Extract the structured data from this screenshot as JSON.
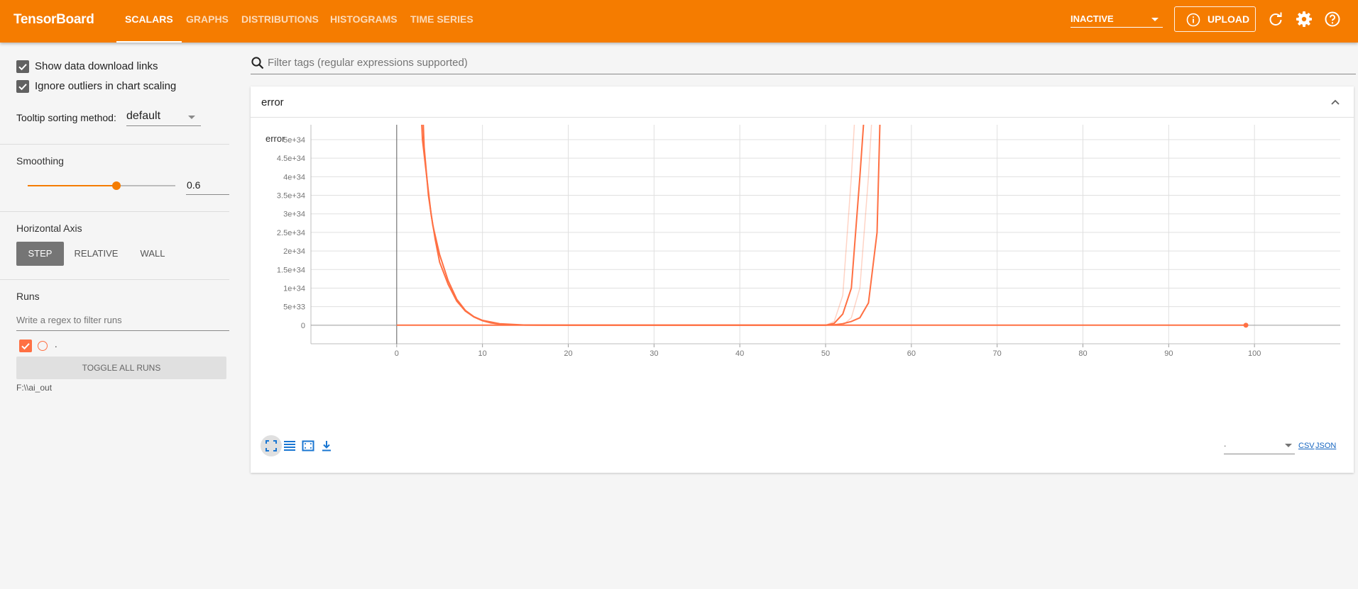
{
  "app": {
    "title": "TensorBoard"
  },
  "nav": {
    "tabs": [
      {
        "label": "SCALARS",
        "active": true
      },
      {
        "label": "GRAPHS"
      },
      {
        "label": "DISTRIBUTIONS"
      },
      {
        "label": "HISTOGRAMS"
      },
      {
        "label": "TIME SERIES"
      }
    ],
    "inactive_select": "INACTIVE",
    "upload_label": "UPLOAD",
    "icons": [
      "refresh-icon",
      "settings-icon",
      "help-icon"
    ]
  },
  "sidebar": {
    "show_download_links": {
      "label": "Show data download links",
      "checked": true
    },
    "ignore_outliers": {
      "label": "Ignore outliers in chart scaling",
      "checked": true
    },
    "tooltip_sorting": {
      "label": "Tooltip sorting method:",
      "value": "default"
    },
    "smoothing": {
      "title": "Smoothing",
      "value": "0.6",
      "fraction": 0.6
    },
    "horizontal_axis": {
      "title": "Horizontal Axis",
      "options": [
        "STEP",
        "RELATIVE",
        "WALL"
      ],
      "selected": "STEP"
    },
    "runs": {
      "title": "Runs",
      "filter_placeholder": "Write a regex to filter runs",
      "items": [
        {
          "name": ".",
          "checked": true,
          "color": "#ff7043"
        }
      ],
      "toggle_all_label": "TOGGLE ALL RUNS",
      "logdir": "F:\\\\ai_out"
    }
  },
  "main": {
    "filter_placeholder": "Filter tags (regular expressions supported)",
    "card": {
      "title": "error"
    },
    "download": {
      "selected": ".",
      "csv": "CSV",
      "json": "JSON"
    }
  },
  "colors": {
    "accent": "#f57c00",
    "run": "#ff7043"
  },
  "chart_data": {
    "type": "line",
    "title": "error",
    "xlabel": "",
    "ylabel": "",
    "xlim": [
      -10,
      110
    ],
    "ylim": [
      -5e+33,
      5.4e+34
    ],
    "x_ticks": [
      0,
      10,
      20,
      30,
      40,
      50,
      60,
      70,
      80,
      90,
      100
    ],
    "x_tick_labels": [
      "0",
      "10",
      "20",
      "30",
      "40",
      "50",
      "60",
      "70",
      "80",
      "90",
      "100"
    ],
    "y_ticks": [
      0,
      5e+33,
      1e+34,
      1.5e+34,
      2e+34,
      2.5e+34,
      3e+34,
      3.5e+34,
      4e+34,
      4.5e+34,
      5e+34
    ],
    "y_tick_labels": [
      "0",
      "5e+33",
      "1e+34",
      "1.5e+34",
      "2e+34",
      "2.5e+34",
      "3e+34",
      "3.5e+34",
      "4e+34",
      "4.5e+34",
      "5e+34"
    ],
    "grid": true,
    "series": [
      {
        "style": "smoothed",
        "points": [
          [
            2.8,
            6e+34
          ],
          [
            3,
            5e+34
          ],
          [
            3.5,
            4e+34
          ],
          [
            4,
            3e+34
          ],
          [
            4.5,
            2.3e+34
          ],
          [
            5,
            1.7e+34
          ],
          [
            6,
            1.1e+34
          ],
          [
            7,
            6.5e+33
          ],
          [
            8,
            3.8e+33
          ],
          [
            9,
            2.2e+33
          ],
          [
            10,
            1.2e+33
          ],
          [
            11,
            6e+32
          ],
          [
            12,
            3e+32
          ],
          [
            14,
            8e+31
          ],
          [
            17,
            1e+31
          ],
          [
            20,
            0
          ],
          [
            50,
            0
          ],
          [
            51,
            1e+32
          ],
          [
            52,
            4e+32
          ],
          [
            53,
            1e+33
          ],
          [
            54,
            2e+33
          ],
          [
            55,
            6e+33
          ],
          [
            56,
            2.5e+34
          ],
          [
            56.4,
            6e+34
          ]
        ]
      },
      {
        "style": "smoothed",
        "points": [
          [
            3,
            6e+34
          ],
          [
            3.2,
            4.8e+34
          ],
          [
            3.7,
            3.5e+34
          ],
          [
            4.2,
            2.7e+34
          ],
          [
            5,
            1.9e+34
          ],
          [
            6,
            1.2e+34
          ],
          [
            7,
            7e+33
          ],
          [
            8,
            4e+33
          ],
          [
            9,
            2.3e+33
          ],
          [
            10,
            1.3e+33
          ],
          [
            12,
            4e+32
          ],
          [
            15,
            5e+31
          ],
          [
            20,
            0
          ],
          [
            50,
            0
          ],
          [
            51,
            5e+32
          ],
          [
            52,
            3e+33
          ],
          [
            53,
            1e+34
          ],
          [
            54,
            4e+34
          ],
          [
            54.6,
            6e+34
          ]
        ]
      },
      {
        "style": "raw",
        "points": [
          [
            50,
            0
          ],
          [
            51,
            1e+33
          ],
          [
            52,
            8e+33
          ],
          [
            53,
            4e+34
          ],
          [
            53.5,
            6e+34
          ]
        ]
      },
      {
        "style": "raw",
        "points": [
          [
            52,
            0
          ],
          [
            53,
            2e+33
          ],
          [
            54,
            1e+34
          ],
          [
            55,
            4e+34
          ],
          [
            55.5,
            6e+34
          ]
        ]
      },
      {
        "style": "flat",
        "points": [
          [
            0,
            0
          ],
          [
            99,
            0
          ]
        ]
      }
    ],
    "marker": {
      "x": 99,
      "y": 0
    }
  }
}
